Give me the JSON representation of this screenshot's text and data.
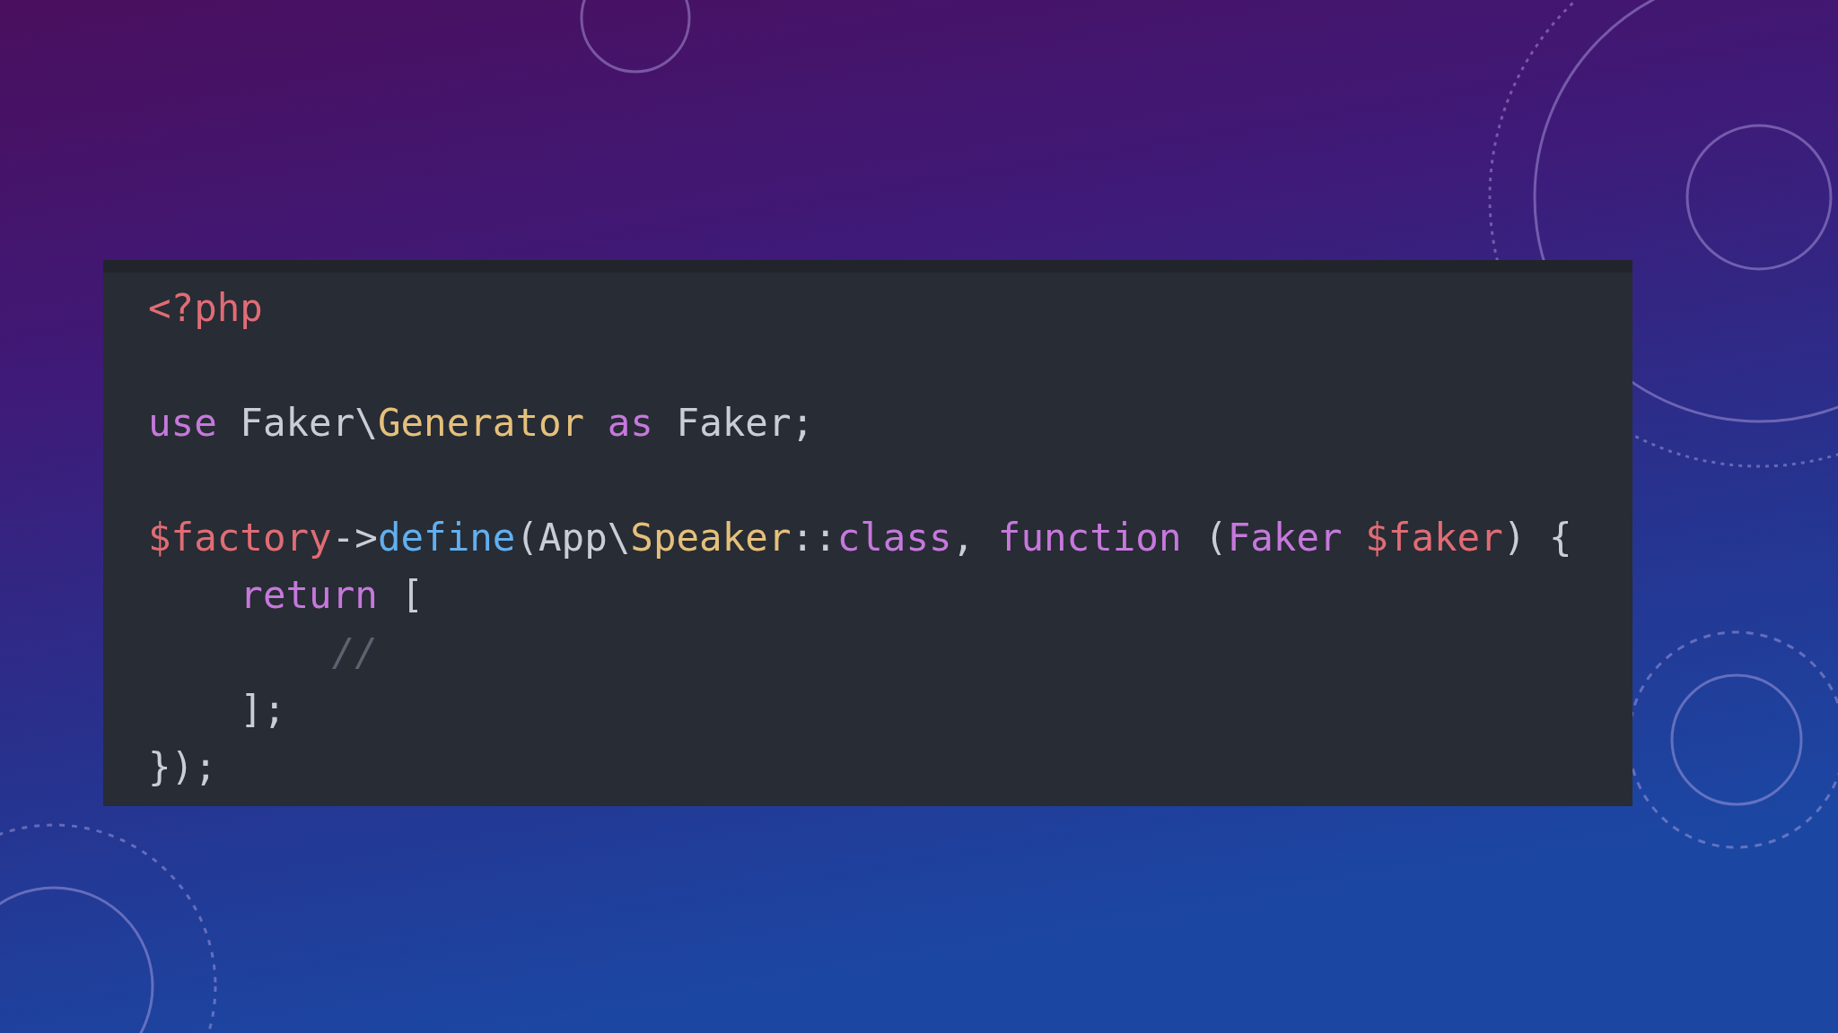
{
  "code_panel": {
    "lines": [
      {
        "kind": "code",
        "tokens": [
          {
            "kind": "tag",
            "text": "<?php"
          }
        ]
      },
      {
        "kind": "blank"
      },
      {
        "kind": "code",
        "tokens": [
          {
            "kind": "keyword",
            "text": "use"
          },
          {
            "kind": "plain",
            "text": " Faker\\"
          },
          {
            "kind": "class",
            "text": "Generator"
          },
          {
            "kind": "keyword",
            "text": " as"
          },
          {
            "kind": "plain",
            "text": " Faker;"
          }
        ]
      },
      {
        "kind": "blank"
      },
      {
        "kind": "code",
        "tokens": [
          {
            "kind": "variable",
            "text": "$factory"
          },
          {
            "kind": "plain",
            "text": "->"
          },
          {
            "kind": "function",
            "text": "define"
          },
          {
            "kind": "plain",
            "text": "(App\\"
          },
          {
            "kind": "class",
            "text": "Speaker"
          },
          {
            "kind": "plain",
            "text": "::"
          },
          {
            "kind": "keyword",
            "text": "class"
          },
          {
            "kind": "plain",
            "text": ", "
          },
          {
            "kind": "keyword",
            "text": "function"
          },
          {
            "kind": "plain",
            "text": " ("
          },
          {
            "kind": "keyword",
            "text": "Faker"
          },
          {
            "kind": "variable",
            "text": " $faker"
          },
          {
            "kind": "plain",
            "text": ") {"
          }
        ]
      },
      {
        "kind": "code",
        "tokens": [
          {
            "kind": "keyword",
            "text": "    return"
          },
          {
            "kind": "plain",
            "text": " ["
          }
        ]
      },
      {
        "kind": "code",
        "tokens": [
          {
            "kind": "comment",
            "text": "        //"
          }
        ]
      },
      {
        "kind": "code",
        "tokens": [
          {
            "kind": "plain",
            "text": "    ];"
          }
        ]
      },
      {
        "kind": "code",
        "tokens": [
          {
            "kind": "plain",
            "text": "});"
          }
        ]
      }
    ]
  }
}
